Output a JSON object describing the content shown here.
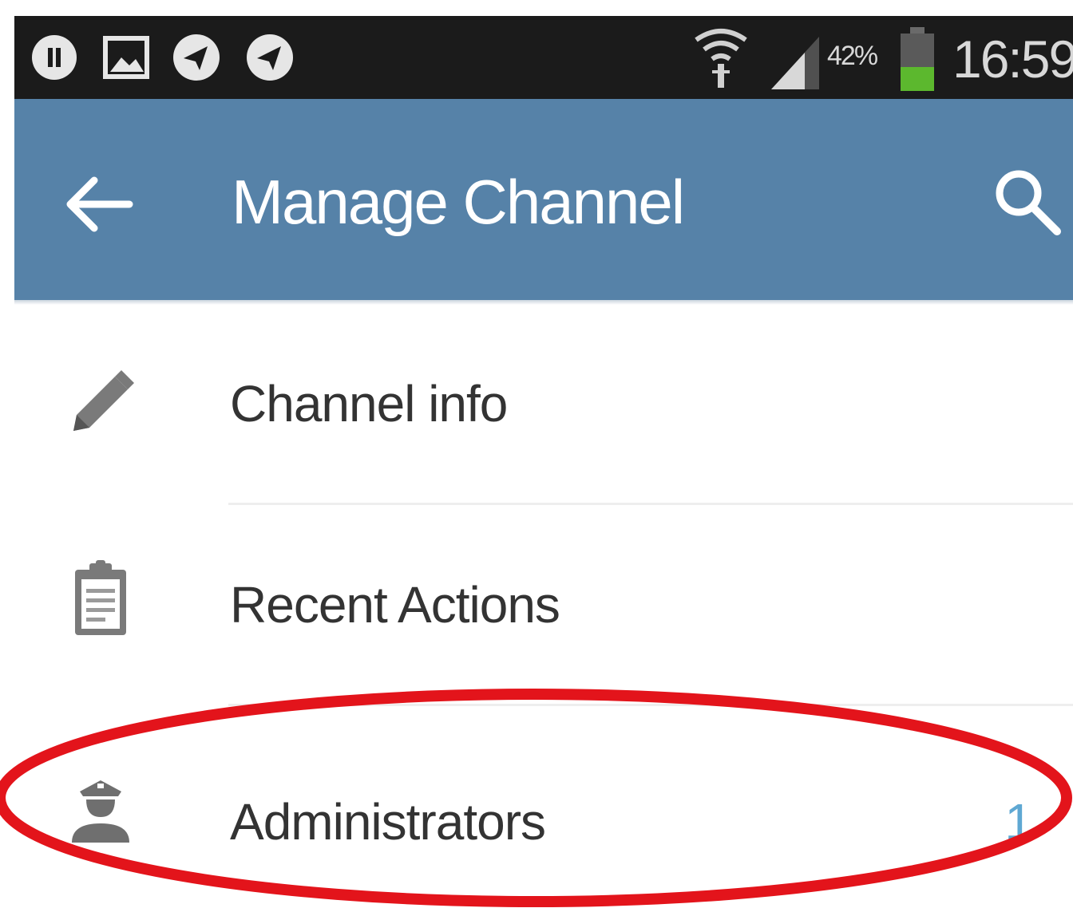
{
  "status_bar": {
    "battery_percent": "42%",
    "time": "16:59",
    "icons": [
      "pause-circle-icon",
      "image-notification-icon",
      "telegram-icon",
      "telegram-icon",
      "wifi-icon",
      "signal-icon",
      "battery-icon"
    ],
    "battery_level": 0.42,
    "battery_color": "#5cb82e"
  },
  "app_bar": {
    "title": "Manage Channel",
    "back_icon": "arrow-left-icon",
    "search_icon": "search-icon",
    "color": "#5682a8"
  },
  "menu": {
    "items": [
      {
        "label": "Channel info",
        "icon": "pencil-icon"
      },
      {
        "label": "Recent Actions",
        "icon": "clipboard-icon"
      },
      {
        "label": "Administrators",
        "icon": "admin-icon",
        "count": "1"
      }
    ]
  },
  "annotation": {
    "shape": "ellipse",
    "color": "#e3141b",
    "target": "Administrators"
  }
}
